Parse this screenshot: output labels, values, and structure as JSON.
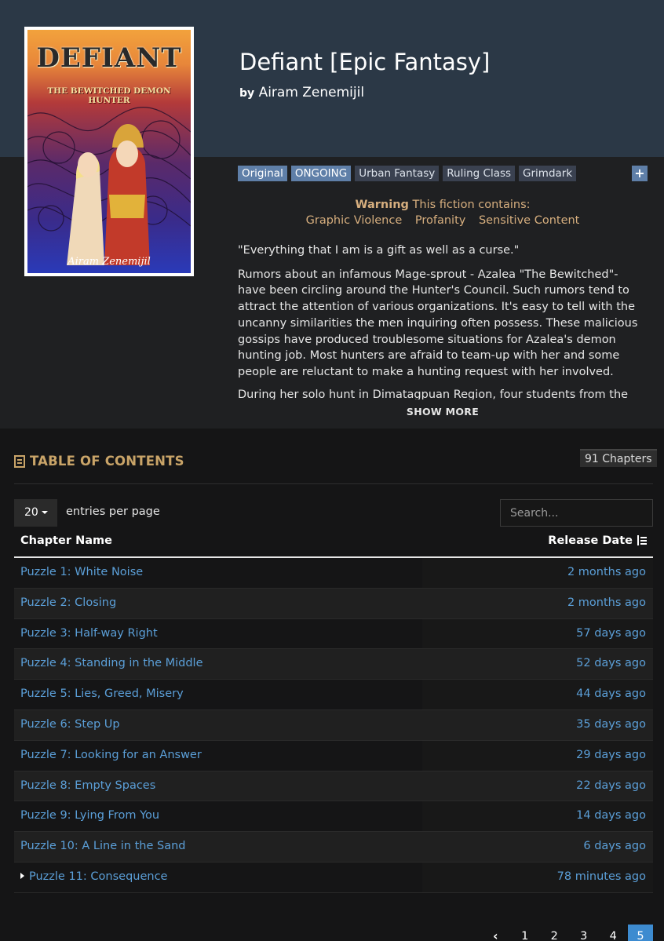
{
  "fiction": {
    "title": "Defiant [Epic Fantasy]",
    "by_label": "by",
    "author": "Airam Zenemijil",
    "cover": {
      "title": "DEFIANT",
      "subtitle": "THE BEWITCHED DEMON HUNTER",
      "author": "Airam Zenemijil"
    },
    "tags": [
      {
        "label": "Original",
        "kind": "label"
      },
      {
        "label": "ONGOING",
        "kind": "label"
      },
      {
        "label": "Urban Fantasy",
        "kind": "genre"
      },
      {
        "label": "Ruling Class",
        "kind": "genre"
      },
      {
        "label": "Grimdark",
        "kind": "genre"
      }
    ],
    "tags_more": "+",
    "warning": {
      "label": "Warning",
      "text": "This fiction contains:",
      "items": [
        "Graphic Violence",
        "Profanity",
        "Sensitive Content"
      ]
    },
    "description": [
      "\"Everything that I am is a gift as well as a curse.\"",
      "Rumors about an infamous Mage-sprout - Azalea \"The Bewitched\"- have been circling around the Hunter's Council. Such rumors tend to attract the attention of various organizations. It's easy to tell with the uncanny similarities the men inquiring often possess. These malicious gossips have produced troublesome situations for Azalea's demon hunting job. Most hunters are afraid to team-up with her and some people are reluctant to make a hunting request with her involved."
    ],
    "description_cut": "During her solo hunt in Dimatagpuan Region, four students from the",
    "show_more": "SHOW MORE"
  },
  "toc": {
    "title": "TABLE OF CONTENTS",
    "chapter_count": "91 Chapters",
    "entries_value": "20",
    "entries_label": "entries per page",
    "search_placeholder": "Search...",
    "col_name": "Chapter Name",
    "col_date": "Release Date",
    "rows": [
      {
        "name": "Puzzle 1: White Noise",
        "date": "2 months ago"
      },
      {
        "name": "Puzzle 2: Closing",
        "date": "2 months ago"
      },
      {
        "name": "Puzzle 3: Half-way Right",
        "date": "57 days ago"
      },
      {
        "name": "Puzzle 4: Standing in the Middle",
        "date": "52 days ago"
      },
      {
        "name": "Puzzle 5: Lies, Greed, Misery",
        "date": "44 days ago"
      },
      {
        "name": "Puzzle 6: Step Up",
        "date": "35 days ago"
      },
      {
        "name": "Puzzle 7: Looking for an Answer",
        "date": "29 days ago"
      },
      {
        "name": "Puzzle 8: Empty Spaces",
        "date": "22 days ago"
      },
      {
        "name": "Puzzle 9: Lying From You",
        "date": "14 days ago"
      },
      {
        "name": "Puzzle 10: A Line in the Sand",
        "date": "6 days ago"
      },
      {
        "name": "Puzzle 11: Consequence",
        "date": "78 minutes ago",
        "current": true
      }
    ],
    "pagination": {
      "prev": "‹",
      "pages": [
        "1",
        "2",
        "3",
        "4",
        "5"
      ],
      "active": "5"
    }
  },
  "colors": {
    "header_bg": "#2b3846",
    "link": "#5b9fd8",
    "accent": "#c9a468",
    "label_tag": "#5f7fa8",
    "active_page": "#3d8bd0"
  }
}
